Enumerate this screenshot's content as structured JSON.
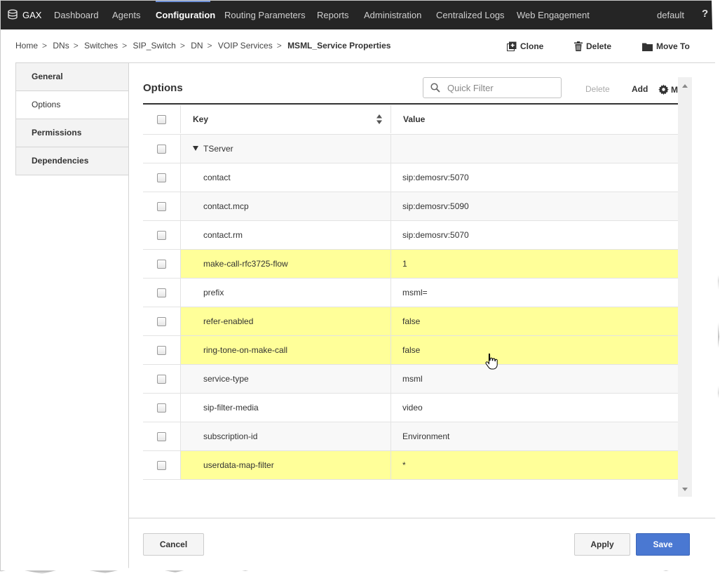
{
  "nav": {
    "logo": "GAX",
    "items": [
      "Dashboard",
      "Agents",
      "Configuration",
      "Routing Parameters",
      "Reports",
      "Administration",
      "Centralized Logs",
      "Web Engagement"
    ],
    "user": "default",
    "help": "?"
  },
  "breadcrumb": {
    "items": [
      "Home",
      "DNs",
      "Switches",
      "SIP_Switch",
      "DN",
      "VOIP Services"
    ],
    "separator": ">",
    "current": "MSML_Service Properties"
  },
  "actions": {
    "clone": "Clone",
    "delete": "Delete",
    "move_to": "Move To"
  },
  "tabs": [
    "General",
    "Options",
    "Permissions",
    "Dependencies"
  ],
  "options": {
    "title": "Options",
    "filter_placeholder": "Quick Filter",
    "delete": "Delete",
    "add": "Add",
    "more": "M"
  },
  "grid": {
    "headers": {
      "key": "Key",
      "value": "Value"
    },
    "group": "TServer",
    "rows": [
      {
        "key": "contact",
        "value": "sip:demosrv:5070"
      },
      {
        "key": "contact.mcp",
        "value": "sip:demosrv:5090"
      },
      {
        "key": "contact.rm",
        "value": "sip:demosrv:5070"
      },
      {
        "key": "make-call-rfc3725-flow",
        "value": "1"
      },
      {
        "key": "prefix",
        "value": "msml="
      },
      {
        "key": "refer-enabled",
        "value": "false"
      },
      {
        "key": "ring-tone-on-make-call",
        "value": "false"
      },
      {
        "key": "service-type",
        "value": "msml"
      },
      {
        "key": "sip-filter-media",
        "value": "video"
      },
      {
        "key": "subscription-id",
        "value": "Environment"
      },
      {
        "key": "userdata-map-filter",
        "value": "*"
      }
    ]
  },
  "footer": {
    "cancel": "Cancel",
    "apply": "Apply",
    "save": "Save"
  },
  "colors": {
    "highlight": "#ffff99",
    "nav_bg": "#252525",
    "primary": "#4a78d2"
  }
}
